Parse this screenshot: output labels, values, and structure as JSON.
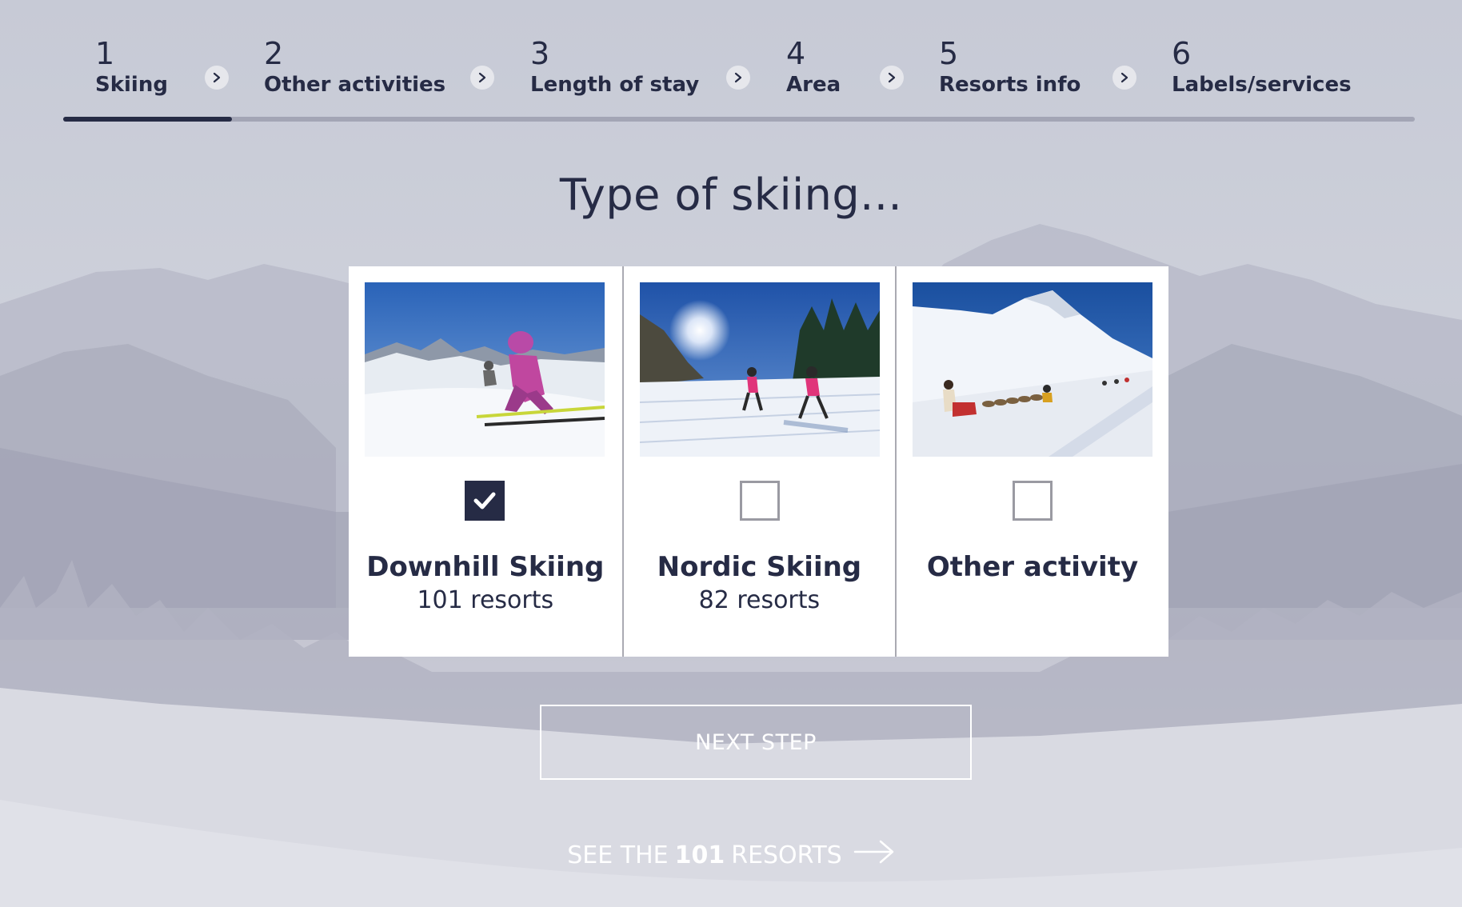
{
  "stepper": {
    "steps": [
      {
        "number": "1",
        "label": "Skiing",
        "active": true
      },
      {
        "number": "2",
        "label": "Other activities",
        "active": false
      },
      {
        "number": "3",
        "label": "Length of stay",
        "active": false
      },
      {
        "number": "4",
        "label": "Area",
        "active": false
      },
      {
        "number": "5",
        "label": "Resorts info",
        "active": false
      },
      {
        "number": "6",
        "label": "Labels/services",
        "active": false
      }
    ],
    "separator_icon": "chevron-right-icon"
  },
  "main": {
    "title": "Type of skiing..."
  },
  "options": [
    {
      "name": "Downhill Skiing",
      "count": "101 resorts",
      "checked": true,
      "photo": "downhill-skier-photo"
    },
    {
      "name": "Nordic Skiing",
      "count": "82 resorts",
      "checked": false,
      "photo": "nordic-skiers-photo"
    },
    {
      "name": "Other activity",
      "count": "",
      "checked": false,
      "photo": "dog-sled-photo"
    }
  ],
  "actions": {
    "next_step_label": "NEXT STEP",
    "see_prefix": "SEE THE",
    "see_count": "101",
    "see_suffix": "RESORTS",
    "see_icon": "arrow-right-icon"
  },
  "colors": {
    "primary": "#262b45",
    "track": "#9698aa",
    "card_bg": "#ffffff",
    "button_text": "#ffffff"
  }
}
